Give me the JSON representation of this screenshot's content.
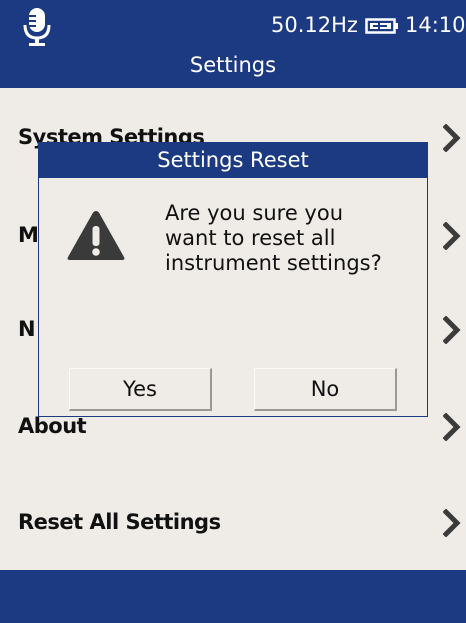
{
  "status_bar": {
    "frequency": "50.12Hz",
    "time": "14:10",
    "icons": [
      "microphone-icon",
      "battery-charging-icon"
    ]
  },
  "header": {
    "title": "Settings"
  },
  "menu": {
    "items": [
      {
        "label": "System Settings"
      },
      {
        "label": "M"
      },
      {
        "label": "N"
      },
      {
        "label": "About"
      },
      {
        "label": "Reset All Settings"
      }
    ],
    "chevron_icon": "chevron-right-icon"
  },
  "dialog": {
    "title": "Settings Reset",
    "icon": "warning-icon",
    "message_lines": [
      "Are you sure you",
      "want to reset all",
      "instrument settings?"
    ],
    "yes_label": "Yes",
    "no_label": "No"
  },
  "colors": {
    "header_bg": "#1c3a82",
    "page_bg": "#efebe7",
    "chevron": "#3b3b3b",
    "warning_icon": "#3a3a3a"
  }
}
